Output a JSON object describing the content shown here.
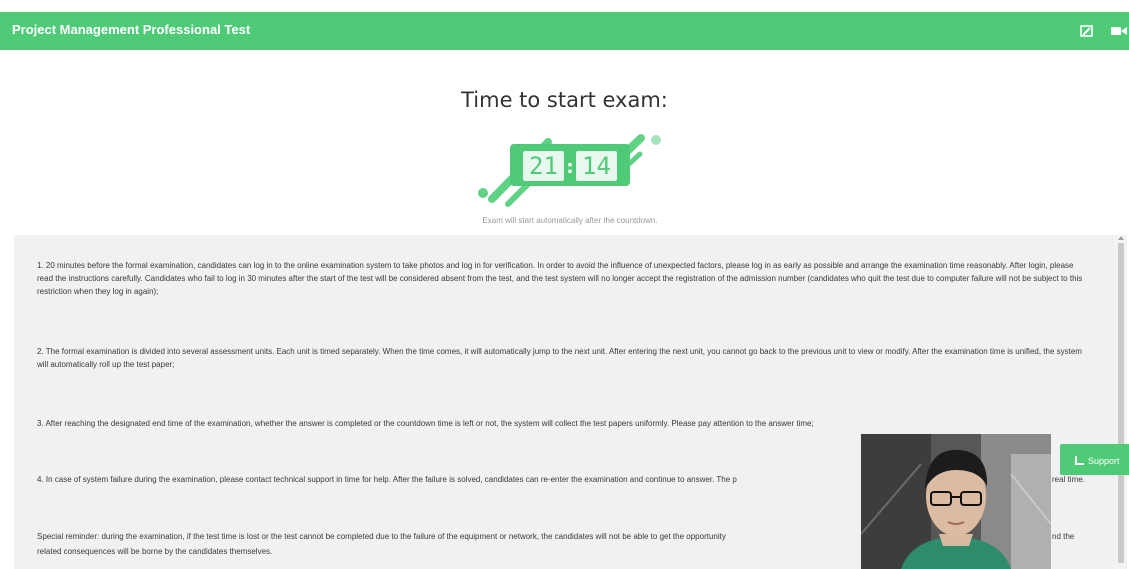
{
  "header": {
    "title": "Project Management Professional Test",
    "icons": [
      "edit-icon",
      "video-camera-icon"
    ],
    "color": "#4fcb78"
  },
  "countdown": {
    "heading": "Time to start exam:",
    "minutes": "21",
    "separator": ":",
    "seconds": "14",
    "note": "Exam will start automatically after the countdown."
  },
  "instructions": {
    "p1": "1. 20 minutes before the formal examination, candidates can log in to the online examination system to take photos and log in for verification. In order to avoid the influence of unexpected factors, please log in as early as possible and arrange the examination time reasonably. After login, please read the instructions carefully. Candidates who fail to log in 30 minutes after the start of the test will be considered absent from the test, and the test system will no longer accept the registration of the admission number (candidates who quit the test due to computer failure will not be subject to this restriction when they log in again);",
    "p2": "2. The formal examination is divided into several assessment units. Each unit is timed separately. When the time comes, it will automatically jump to the next unit. After entering the next unit, you cannot go back to the previous unit to view or modify. After the examination time is unified, the system will automatically roll up the test paper;",
    "p3": "3. After reaching the designated end time of the examination, whether the answer is completed or the countdown time is left or not, the system will collect the test papers uniformly. Please pay attention to the answer time;",
    "p4a": "4. In case of system failure during the examination, please contact technical support in time for help. After the failure is solved, candidates can re-enter the examination and continue to answer. The p",
    "p4b": "real time.",
    "p5a": "Special reminder: during the examination, if the test time is lost or the test cannot be completed due to the failure of the equipment or network, the candidates will not be able to get the opportunity",
    "p5b": "nd the",
    "p5c": "related consequences will be borne by the candidates themselves."
  },
  "support": {
    "label": "Support"
  }
}
